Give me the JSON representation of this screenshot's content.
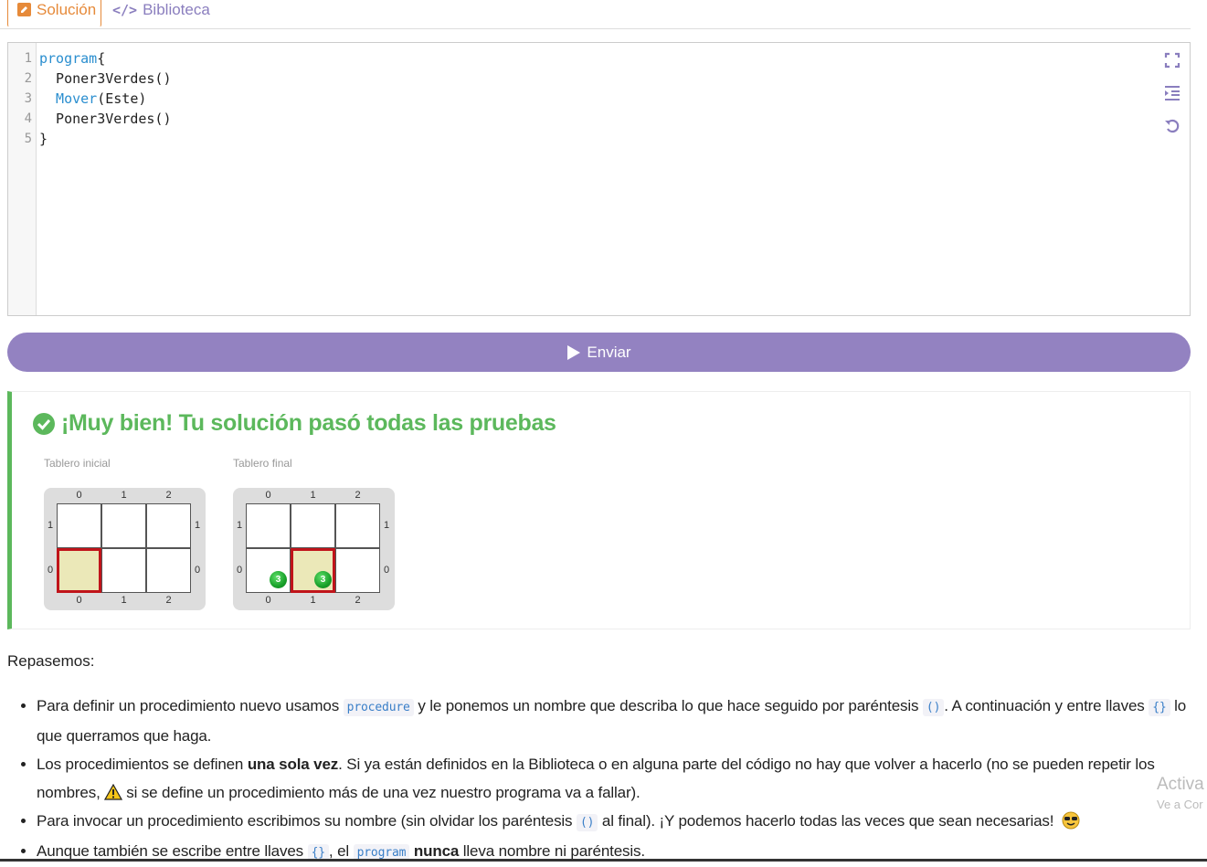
{
  "tabs": {
    "solucion": "Solución",
    "biblioteca": "Biblioteca"
  },
  "editor": {
    "lines": [
      {
        "n": "1",
        "kw": "program",
        "rest": "{"
      },
      {
        "n": "2",
        "kw": "",
        "rest": "  Poner3Verdes()"
      },
      {
        "n": "3",
        "kw": "  Mover",
        "rest": "(Este)"
      },
      {
        "n": "4",
        "kw": "",
        "rest": "  Poner3Verdes()"
      },
      {
        "n": "5",
        "kw": "",
        "rest": "}"
      }
    ],
    "tools": [
      "fullscreen-icon",
      "indent-icon",
      "reset-icon"
    ]
  },
  "submit": {
    "label": "Enviar"
  },
  "result": {
    "title": "¡Muy bien! Tu solución pasó todas las pruebas",
    "initial_label": "Tablero inicial",
    "final_label": "Tablero final",
    "col_coords": [
      "0",
      "1",
      "2"
    ],
    "row_coords": [
      "1",
      "0"
    ],
    "initial_board": {
      "head": [
        1,
        0
      ],
      "balls": []
    },
    "final_board": {
      "head": [
        1,
        1
      ],
      "balls": [
        {
          "row": 1,
          "col": 0,
          "count": "3"
        },
        {
          "row": 1,
          "col": 1,
          "count": "3"
        }
      ]
    },
    "success_color": "#5cb85c"
  },
  "review": {
    "heading": "Repasemos:",
    "item1_a": "Para definir un procedimiento nuevo usamos",
    "item1_code1": "procedure",
    "item1_b": "y le ponemos un nombre que describa lo que hace seguido por paréntesis",
    "item1_code2": "()",
    "item1_c": ". A continuación y entre llaves",
    "item1_code3": "{}",
    "item1_d": "lo que querramos que haga.",
    "item2_a": "Los procedimientos se definen",
    "item2_bold": "una sola vez",
    "item2_b": ". Si ya están definidos en la Biblioteca o en alguna parte del código no hay que volver a hacerlo (no se pueden repetir los nombres,",
    "item2_c": "si se define un procedimiento más de una vez nuestro programa va a fallar).",
    "item3_a": "Para invocar un procedimiento escribimos su nombre (sin olvidar los paréntesis",
    "item3_code": "()",
    "item3_b": "al final). ¡Y podemos hacerlo todas las veces que sean necesarias!",
    "item4_a": "Aunque también se escribe entre llaves",
    "item4_code1": "{}",
    "item4_b": ", el",
    "item4_code2": "program",
    "item4_bold": "nunca",
    "item4_c": "lleva nombre ni paréntesis."
  },
  "watermark": {
    "line1": "Activa",
    "line2": "Ve a Cor"
  }
}
